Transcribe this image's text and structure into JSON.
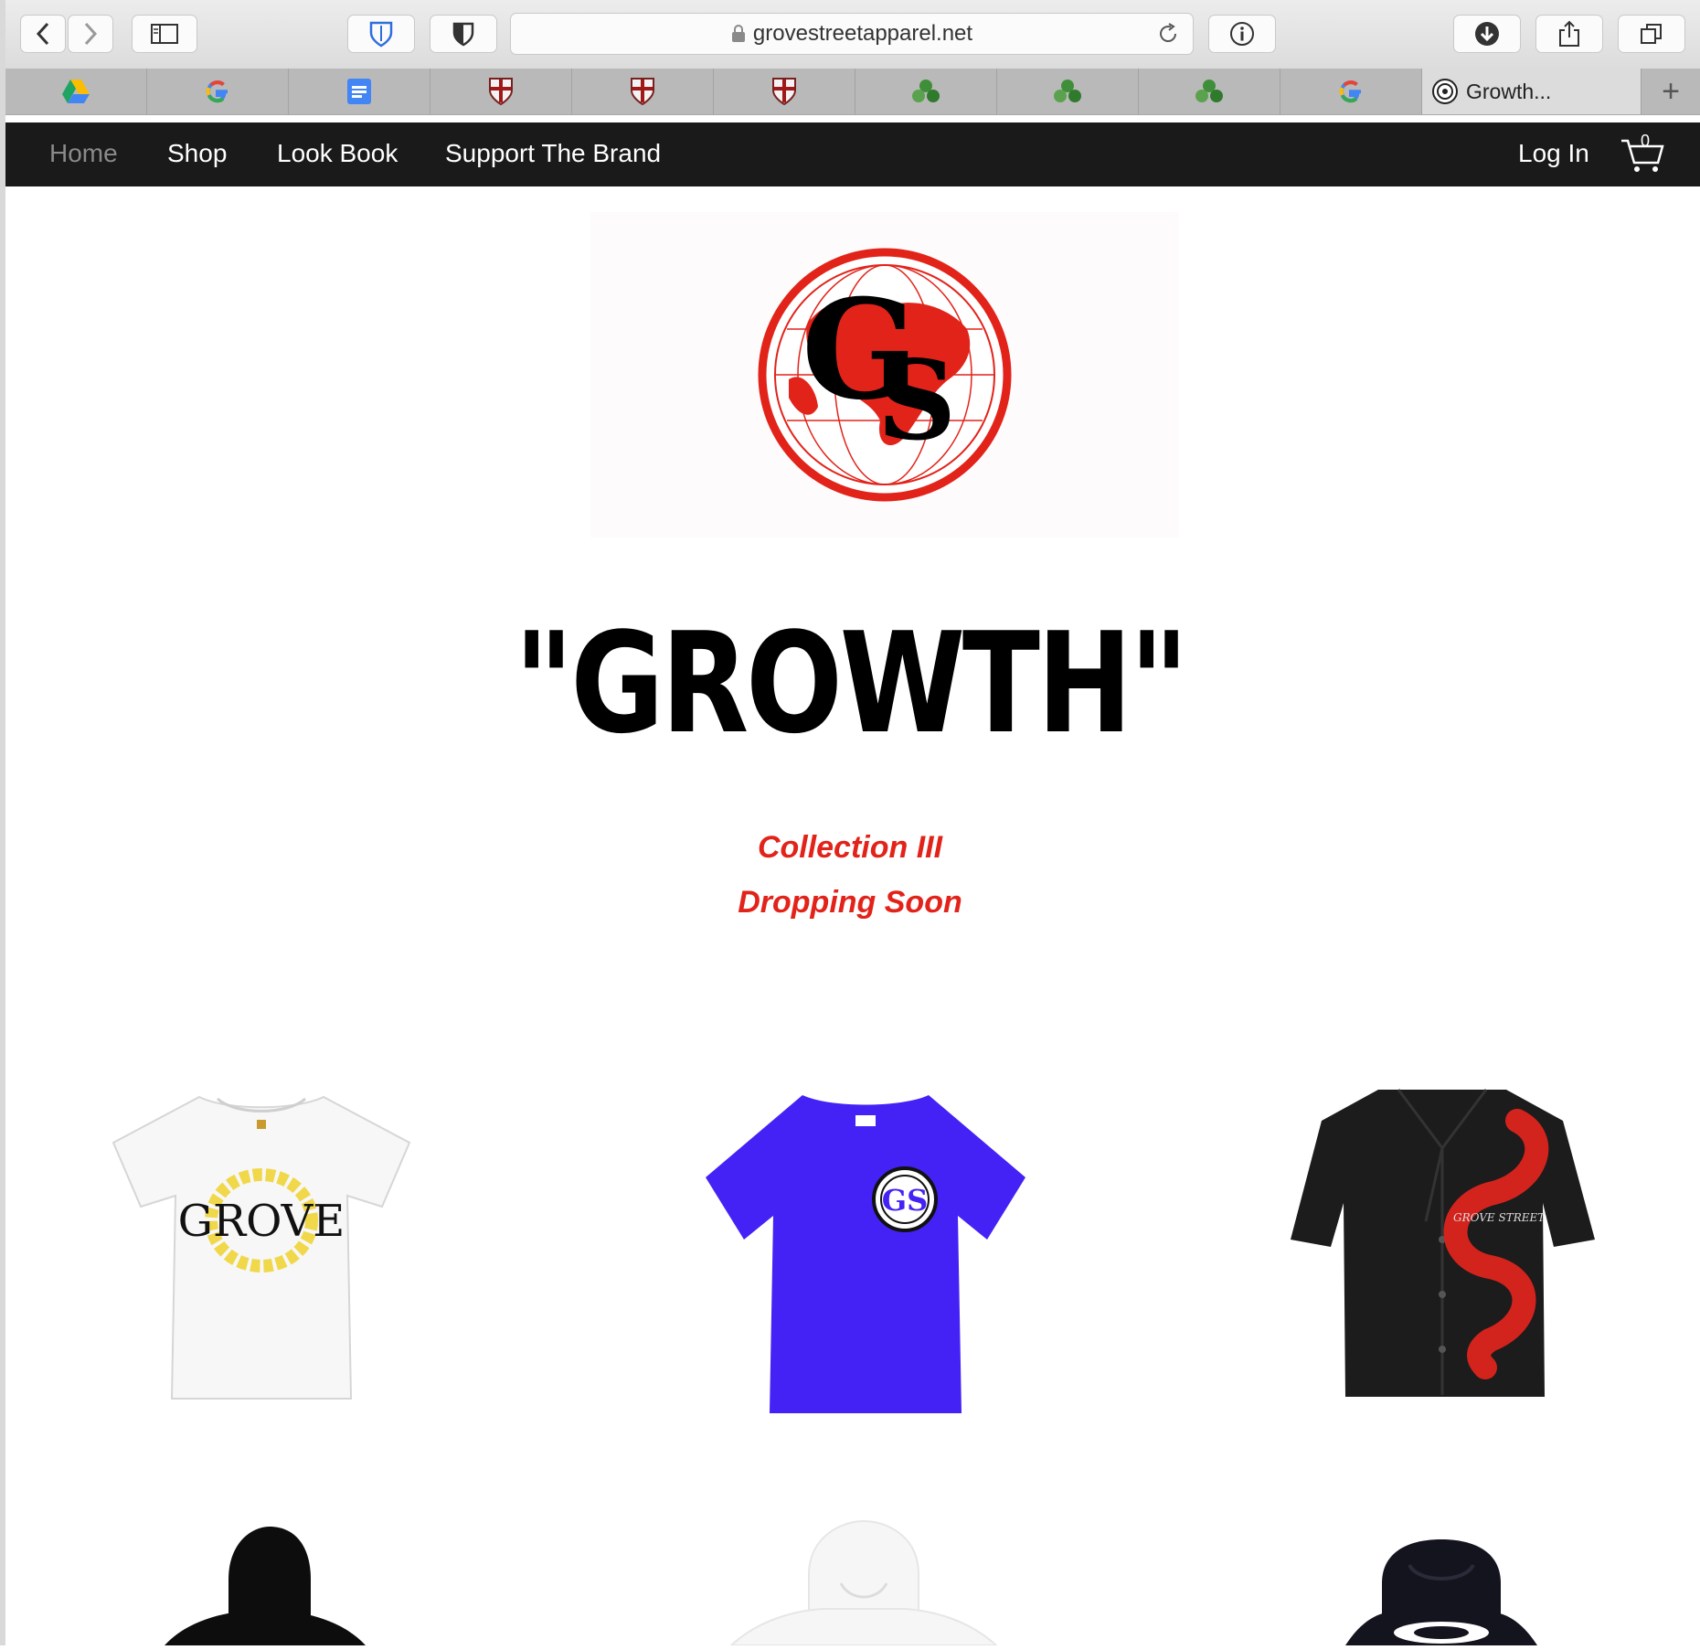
{
  "browser": {
    "url": "grovestreetapparel.net",
    "active_tab_title": "Growth...",
    "tabs": [
      {
        "icon": "google-drive-icon"
      },
      {
        "icon": "google-icon"
      },
      {
        "icon": "google-docs-icon"
      },
      {
        "icon": "shield-crest-icon"
      },
      {
        "icon": "shield-crest-icon"
      },
      {
        "icon": "shield-crest-icon"
      },
      {
        "icon": "green-clover-icon"
      },
      {
        "icon": "green-clover-icon"
      },
      {
        "icon": "green-clover-icon"
      },
      {
        "icon": "google-icon"
      }
    ],
    "new_tab_label": "+"
  },
  "nav": {
    "home": "Home",
    "shop": "Shop",
    "lookbook": "Look Book",
    "support": "Support The Brand",
    "login": "Log In",
    "cart_count": "0"
  },
  "hero": {
    "headline": "\"GROWTH\"",
    "line1": "Collection III",
    "line2": "Dropping Soon"
  },
  "products": [
    {
      "name": "white grove tee",
      "print": "GROVE"
    },
    {
      "name": "blue logo tee"
    },
    {
      "name": "black snake shirt",
      "print": "GROVE STREET"
    },
    {
      "name": "black hoodie"
    },
    {
      "name": "white hoodie"
    },
    {
      "name": "black graphic hoodie"
    }
  ],
  "colors": {
    "accent": "#e2231a",
    "nav_bg": "#1a1a1a",
    "blue_tee": "#4422f5"
  }
}
